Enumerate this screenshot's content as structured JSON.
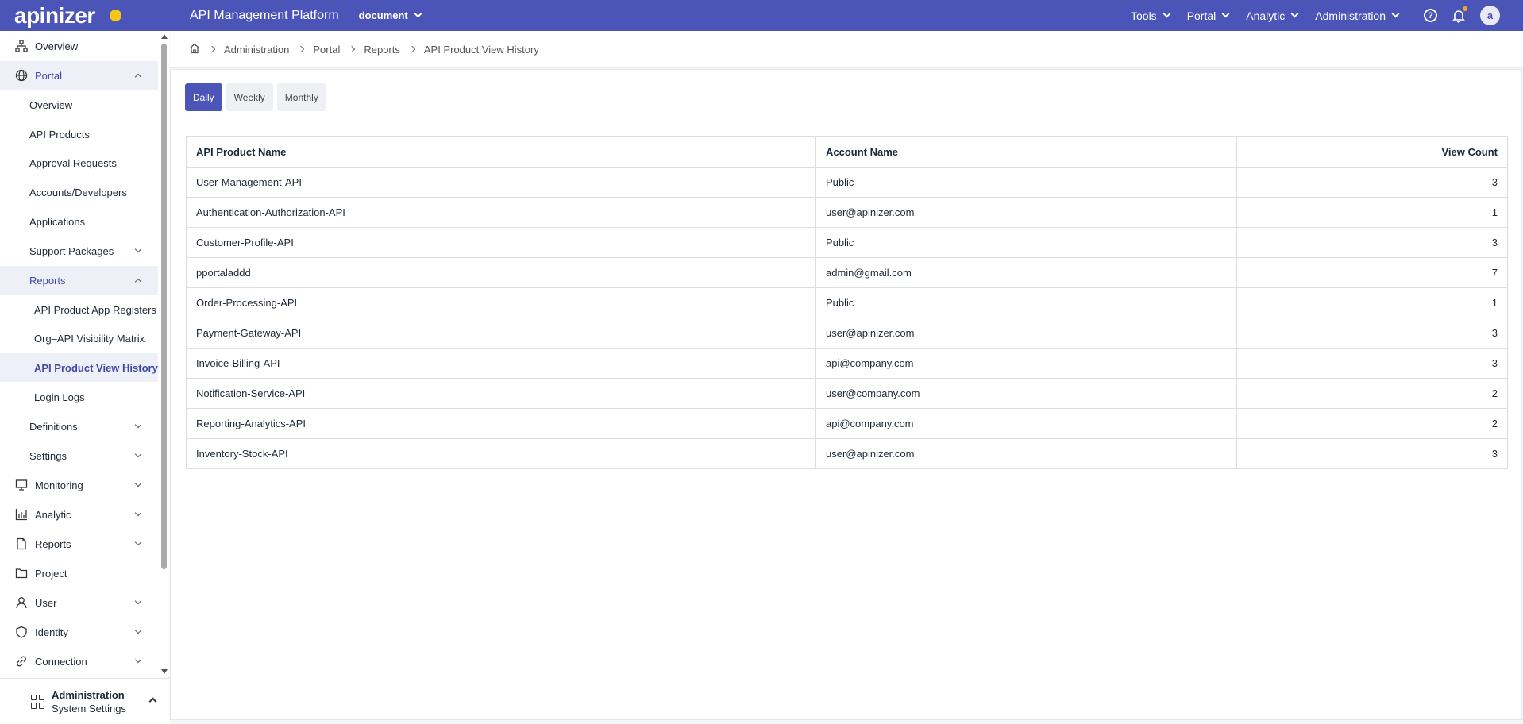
{
  "topbar": {
    "logo": "apinizer",
    "platform_title": "API Management Platform",
    "workspace": "document",
    "menus": [
      "Tools",
      "Portal",
      "Analytic",
      "Administration"
    ],
    "avatar_letter": "a",
    "logo_dot_color": "#f5c518"
  },
  "sidebar": {
    "items": [
      {
        "label": "Overview",
        "icon": "sitemap-icon"
      },
      {
        "label": "Portal",
        "icon": "globe-icon"
      },
      {
        "label": "Overview"
      },
      {
        "label": "API Products"
      },
      {
        "label": "Approval Requests"
      },
      {
        "label": "Accounts/Developers"
      },
      {
        "label": "Applications"
      },
      {
        "label": "Support Packages"
      },
      {
        "label": "Reports"
      },
      {
        "label": "API Product App Registers"
      },
      {
        "label": "Org–API Visibility Matrix"
      },
      {
        "label": "API Product View History"
      },
      {
        "label": "Login Logs"
      },
      {
        "label": "Definitions"
      },
      {
        "label": "Settings"
      },
      {
        "label": "Monitoring",
        "icon": "monitor-icon"
      },
      {
        "label": "Analytic",
        "icon": "bar-chart-icon"
      },
      {
        "label": "Reports",
        "icon": "file-icon"
      },
      {
        "label": "Project",
        "icon": "folder-icon"
      },
      {
        "label": "User",
        "icon": "user-icon"
      },
      {
        "label": "Identity",
        "icon": "shield-icon"
      },
      {
        "label": "Connection",
        "icon": "link-icon"
      }
    ],
    "footer": {
      "title": "Administration",
      "subtitle": "System Settings"
    }
  },
  "breadcrumb": [
    "Administration",
    "Portal",
    "Reports",
    "API Product View History"
  ],
  "tabs": [
    "Daily",
    "Weekly",
    "Monthly"
  ],
  "table": {
    "headers": [
      "API Product Name",
      "Account Name",
      "View Count"
    ],
    "rows": [
      [
        "User-Management-API",
        "Public",
        "3"
      ],
      [
        "Authentication-Authorization-API",
        "user@apinizer.com",
        "1"
      ],
      [
        "Customer-Profile-API",
        "Public",
        "3"
      ],
      [
        "pportaladdd",
        "admin@gmail.com",
        "7"
      ],
      [
        "Order-Processing-API",
        "Public",
        "1"
      ],
      [
        "Payment-Gateway-API",
        "user@apinizer.com",
        "3"
      ],
      [
        "Invoice-Billing-API",
        "api@company.com",
        "3"
      ],
      [
        "Notification-Service-API",
        "user@company.com",
        "2"
      ],
      [
        "Reporting-Analytics-API",
        "api@company.com",
        "2"
      ],
      [
        "Inventory-Stock-API",
        "user@apinizer.com",
        "3"
      ]
    ]
  },
  "colors": {
    "accent": "#4b55b8",
    "notification": "#f5a623"
  }
}
